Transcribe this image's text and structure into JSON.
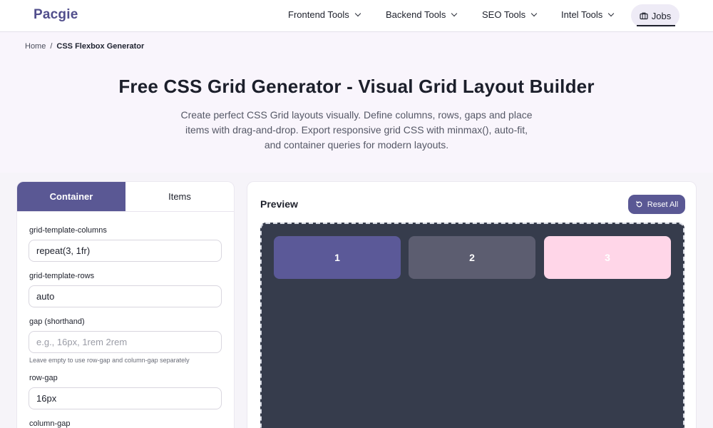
{
  "brand": {
    "logo": "Pacgie"
  },
  "nav": {
    "items": [
      {
        "label": "Frontend Tools"
      },
      {
        "label": "Backend Tools"
      },
      {
        "label": "SEO Tools"
      },
      {
        "label": "Intel Tools"
      }
    ],
    "jobs_label": "Jobs"
  },
  "breadcrumb": {
    "home": "Home",
    "separator": "/",
    "current": "CSS Flexbox Generator"
  },
  "hero": {
    "title": "Free CSS Grid Generator - Visual Grid Layout Builder",
    "description": "Create perfect CSS Grid layouts visually. Define columns, rows, gaps and place items with drag-and-drop. Export responsive grid CSS with minmax(), auto-fit, and container queries for modern layouts."
  },
  "panel": {
    "tabs": [
      {
        "label": "Container",
        "active": true
      },
      {
        "label": "Items",
        "active": false
      }
    ],
    "fields": {
      "columns": {
        "label": "grid-template-columns",
        "value": "repeat(3, 1fr)"
      },
      "rows": {
        "label": "grid-template-rows",
        "value": "auto"
      },
      "gap": {
        "label": "gap (shorthand)",
        "value": "",
        "placeholder": "e.g., 16px, 1rem 2rem",
        "hint": "Leave empty to use row-gap and column-gap separately"
      },
      "row_gap": {
        "label": "row-gap",
        "value": "16px"
      },
      "column_gap": {
        "label": "column-gap"
      }
    }
  },
  "preview": {
    "title": "Preview",
    "reset_label": "Reset All",
    "items": [
      {
        "label": "1",
        "color": "#5b5998"
      },
      {
        "label": "2",
        "color": "#5c5d70"
      },
      {
        "label": "3",
        "color": "#ffd6e8"
      }
    ]
  },
  "colors": {
    "accent": "#5a5894",
    "canvas": "#363c4c",
    "logo": "#514e8c"
  }
}
